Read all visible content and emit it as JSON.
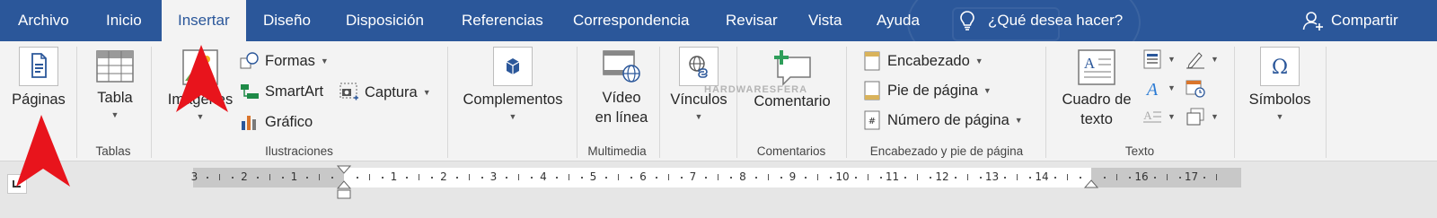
{
  "tabs": [
    "Archivo",
    "Inicio",
    "Insertar",
    "Diseño",
    "Disposición",
    "Referencias",
    "Correspondencia",
    "Revisar",
    "Vista",
    "Ayuda"
  ],
  "active_tab": "Insertar",
  "tell_me": "¿Qué desea hacer?",
  "share": "Compartir",
  "watermark": "HARDWARESFERA",
  "groups": {
    "paginas": {
      "button": "Páginas"
    },
    "tablas": {
      "button": "Tabla",
      "label": "Tablas"
    },
    "ilustraciones": {
      "label": "Ilustraciones",
      "imagenes": "Imágenes",
      "formas": "Formas",
      "smartart": "SmartArt",
      "grafico": "Gráfico",
      "captura": "Captura"
    },
    "complementos": {
      "button": "Complementos"
    },
    "multimedia": {
      "label": "Multimedia",
      "video_line1": "Vídeo",
      "video_line2": "en línea",
      "vinculos": "Vínculos"
    },
    "comentarios": {
      "label": "Comentarios",
      "button": "Comentario"
    },
    "encabezado": {
      "label": "Encabezado y pie de página",
      "encabezado": "Encabezado",
      "pie": "Pie de página",
      "numero": "Número de página"
    },
    "texto": {
      "label": "Texto",
      "line1": "Cuadro de",
      "line2": "texto"
    },
    "simbolos": {
      "button": "Símbolos"
    }
  },
  "ruler": {
    "numbers": [
      "3",
      "2",
      "1",
      "1",
      "2",
      "3",
      "4",
      "5",
      "6",
      "7",
      "8",
      "9",
      "10",
      "11",
      "12",
      "13",
      "14",
      "16",
      "17"
    ]
  },
  "colors": {
    "ribbon_blue": "#2b579a",
    "annotation_red": "#e8141c"
  }
}
